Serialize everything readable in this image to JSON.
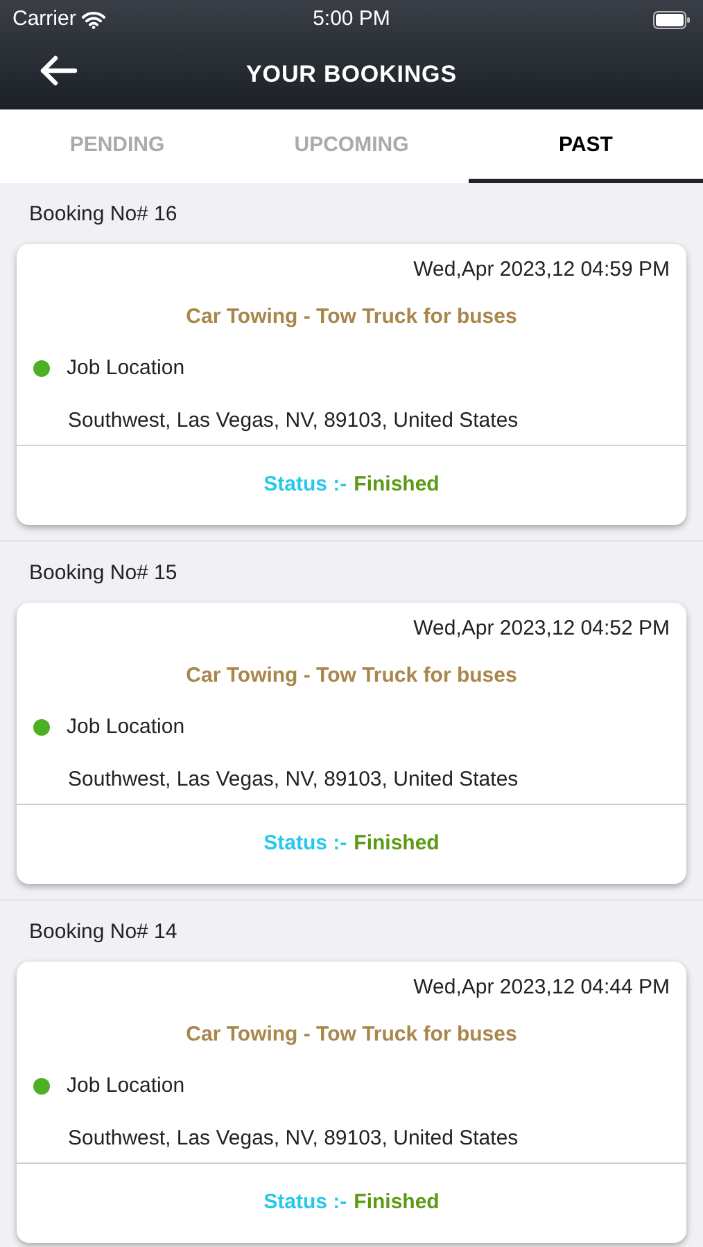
{
  "status_bar": {
    "carrier": "Carrier",
    "time": "5:00 PM"
  },
  "nav": {
    "title": "YOUR BOOKINGS"
  },
  "tabs": [
    {
      "label": "PENDING",
      "selected": false
    },
    {
      "label": "UPCOMING",
      "selected": false
    },
    {
      "label": "PAST",
      "selected": true
    }
  ],
  "bookings": [
    {
      "number": "Booking No# 16",
      "datetime": "Wed,Apr 2023,12 04:59 PM",
      "service": "Car Towing - Tow Truck for buses",
      "location_label": "Job Location",
      "color": "#4caf24",
      "address": "Southwest, Las Vegas, NV, 89103, United States",
      "status_label": "Status :-",
      "status": "Finished"
    },
    {
      "number": "Booking No# 15",
      "datetime": "Wed,Apr 2023,12 04:52 PM",
      "service": "Car Towing - Tow Truck for buses",
      "location_label": "Job Location",
      "color": "#4caf24",
      "address": "Southwest, Las Vegas, NV, 89103, United States",
      "status_label": "Status :-",
      "status": "Finished"
    },
    {
      "number": "Booking No# 14",
      "datetime": "Wed,Apr 2023,12 04:44 PM",
      "service": "Car Towing - Tow Truck for buses",
      "location_label": "Job Location",
      "color": "#4caf24",
      "address": "Southwest, Las Vegas, NV, 89103, United States",
      "status_label": "Status :-",
      "status": "Finished"
    }
  ]
}
